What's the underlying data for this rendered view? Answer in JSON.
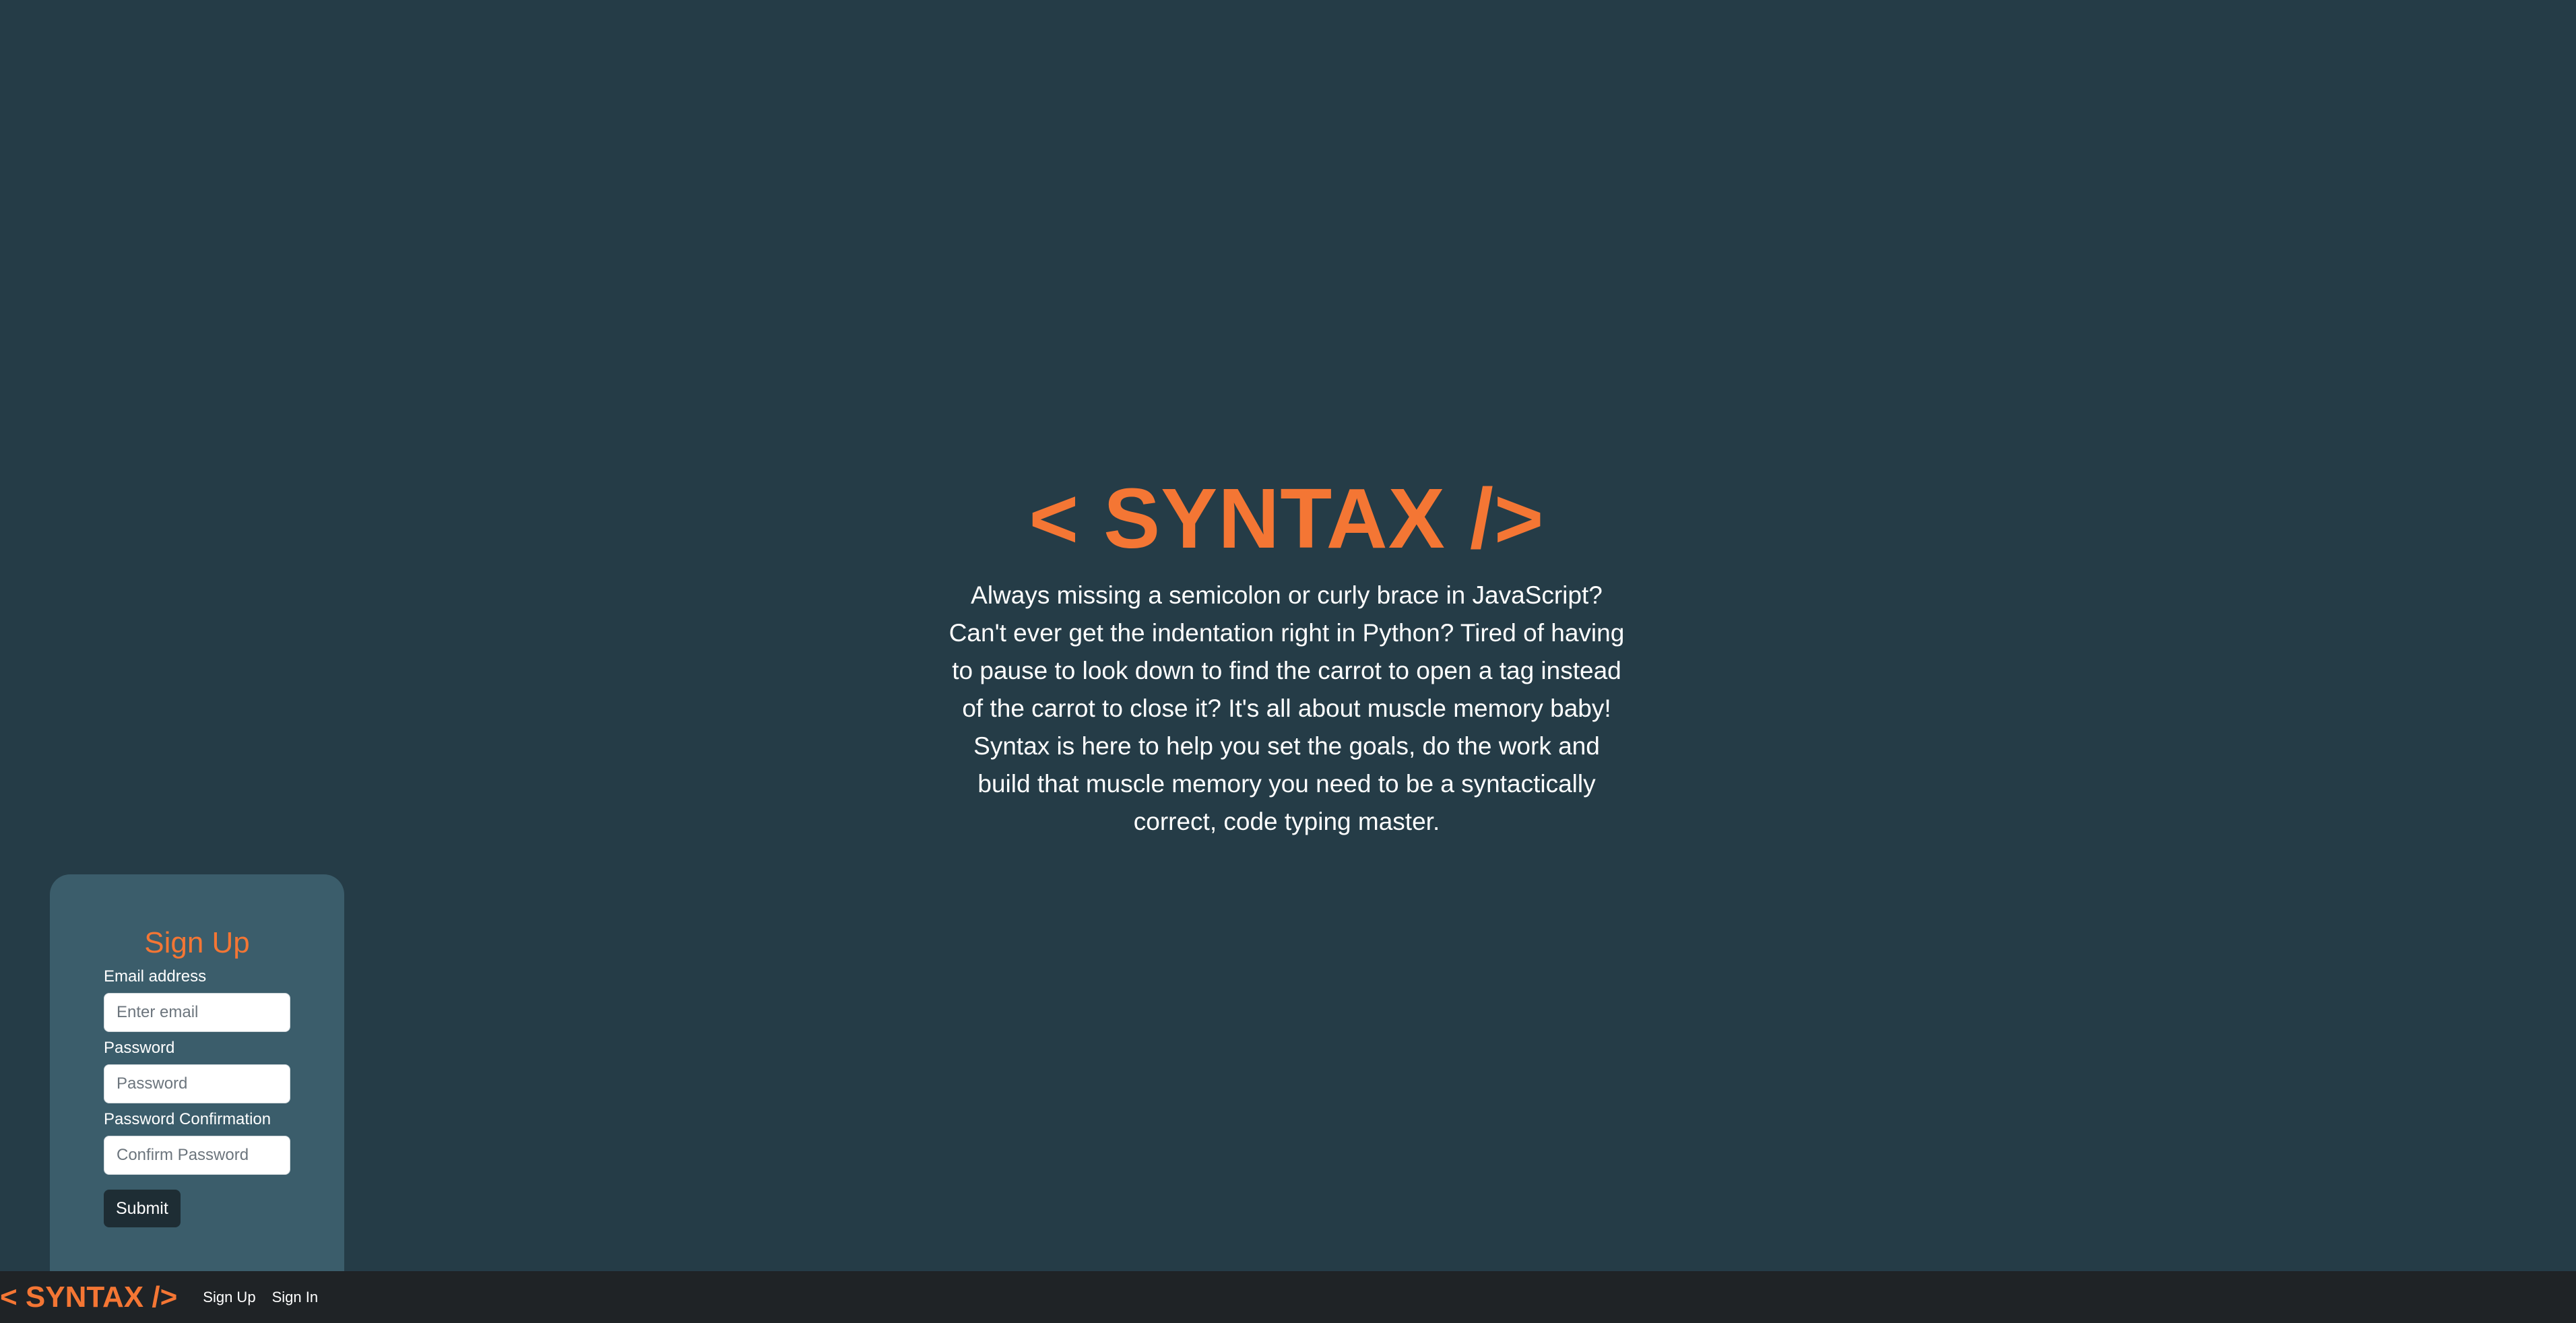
{
  "hero": {
    "title": "< SYNTAX />",
    "description": "Always missing a semicolon or curly brace in JavaScript? Can't ever get the indentation right in Python? Tired of having to pause to look down to find the carrot to open a tag instead of the carrot to close it? It's all about muscle memory baby! Syntax is here to help you set the goals, do the work and build that muscle memory you need to be a syntactically correct, code typing master."
  },
  "signup": {
    "title": "Sign Up",
    "email_label": "Email address",
    "email_placeholder": "Enter email",
    "password_label": "Password",
    "password_placeholder": "Password",
    "confirm_label": "Password Confirmation",
    "confirm_placeholder": "Confirm Password",
    "submit_label": "Submit"
  },
  "navbar": {
    "brand": "< SYNTAX />",
    "links": [
      {
        "label": "Sign Up"
      },
      {
        "label": "Sign In"
      }
    ]
  },
  "colors": {
    "background": "#253c47",
    "accent": "#f47634",
    "card": "#3b5d6b",
    "navbar": "#1f2326",
    "button": "#1e2d34"
  }
}
